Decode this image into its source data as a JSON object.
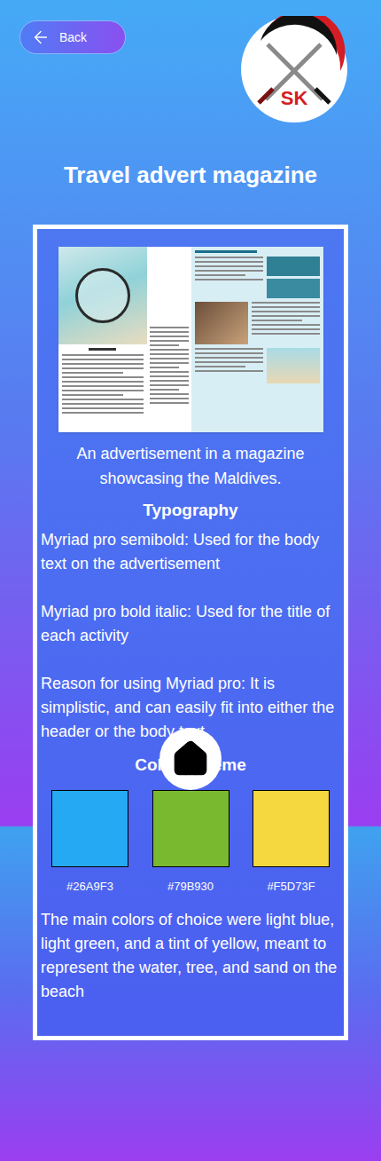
{
  "back_button": {
    "label": "Back"
  },
  "logo": {
    "text": "SK"
  },
  "title": "Travel advert magazine",
  "caption": "An advertisement in a magazine showcasing the Maldives.",
  "typography": {
    "heading": "Typography",
    "items": [
      "Myriad pro semibold: Used for the body text on the advertisement",
      "Myriad pro bold italic: Used for the title of each activity",
      "Reason for using Myriad pro: It is simplistic, and can easily fit into either the header or the body text"
    ]
  },
  "color_scheme": {
    "heading": "Color scheme",
    "swatches": [
      {
        "label": "#26A9F3",
        "color": "#26A9F3"
      },
      {
        "label": "#79B930",
        "color": "#79B930"
      },
      {
        "label": "#F5D73F",
        "color": "#F5D73F"
      }
    ],
    "description": "The main colors of choice were light blue, light green, and a tint of yellow, meant to represent the water, tree, and sand on the beach"
  }
}
